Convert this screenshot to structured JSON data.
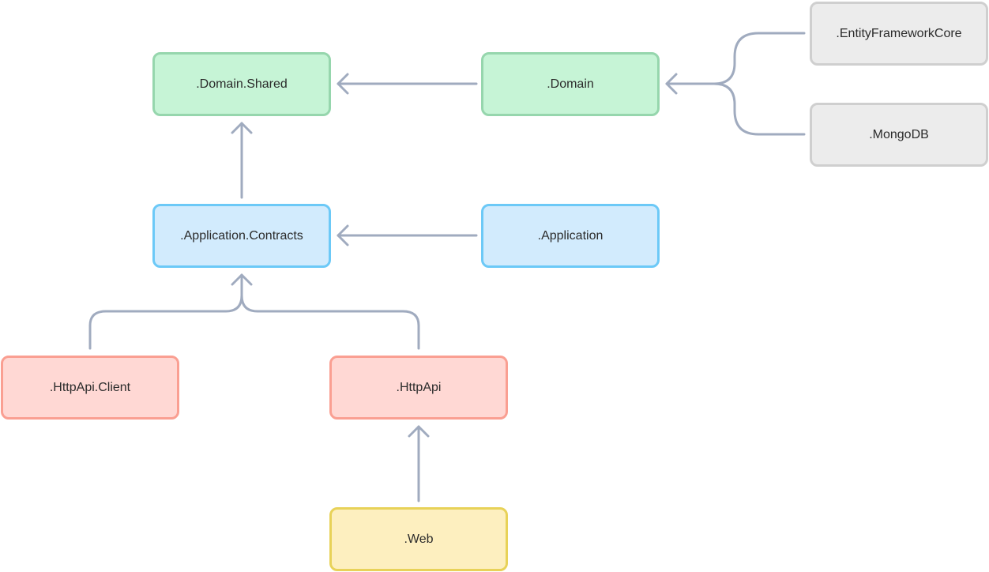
{
  "diagram": {
    "nodes": [
      {
        "id": "domain-shared",
        "label": ".Domain.Shared",
        "group": "domain"
      },
      {
        "id": "domain",
        "label": ".Domain",
        "group": "domain"
      },
      {
        "id": "efcore",
        "label": ".EntityFrameworkCore",
        "group": "data"
      },
      {
        "id": "mongodb",
        "label": ".MongoDB",
        "group": "data"
      },
      {
        "id": "app-contracts",
        "label": ".Application.Contracts",
        "group": "application"
      },
      {
        "id": "application",
        "label": ".Application",
        "group": "application"
      },
      {
        "id": "httpapi-client",
        "label": ".HttpApi.Client",
        "group": "httpapi"
      },
      {
        "id": "httpapi",
        "label": ".HttpApi",
        "group": "httpapi"
      },
      {
        "id": "web",
        "label": ".Web",
        "group": "web"
      }
    ],
    "edges": [
      {
        "from": "domain",
        "to": "domain-shared"
      },
      {
        "from": "efcore",
        "to": "domain"
      },
      {
        "from": "mongodb",
        "to": "domain"
      },
      {
        "from": "app-contracts",
        "to": "domain-shared"
      },
      {
        "from": "application",
        "to": "app-contracts"
      },
      {
        "from": "httpapi-client",
        "to": "app-contracts"
      },
      {
        "from": "httpapi",
        "to": "app-contracts"
      },
      {
        "from": "web",
        "to": "httpapi"
      }
    ],
    "colors": {
      "domain": {
        "fill": "#c6f4d6",
        "border": "#96d6ad"
      },
      "data": {
        "fill": "#ececec",
        "border": "#cfcfcf"
      },
      "application": {
        "fill": "#d2ebfd",
        "border": "#6cc9f7"
      },
      "httpapi": {
        "fill": "#ffd8d4",
        "border": "#fa9f92"
      },
      "web": {
        "fill": "#fdefbf",
        "border": "#e8d258"
      },
      "edge": "#a0abbf"
    }
  }
}
